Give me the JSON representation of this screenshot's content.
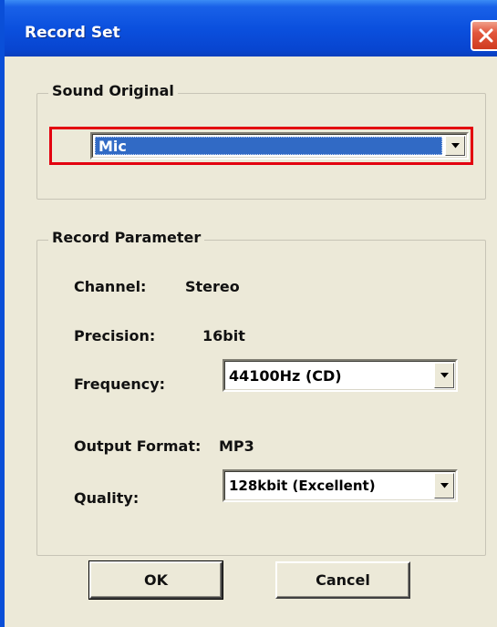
{
  "window": {
    "title": "Record Set"
  },
  "sound_original": {
    "legend": "Sound Original",
    "source_value": "Mic"
  },
  "record_parameter": {
    "legend": "Record Parameter",
    "channel_label": "Channel:",
    "channel_value": "Stereo",
    "precision_label": "Precision:",
    "precision_value": "16bit",
    "frequency_label": "Frequency:",
    "frequency_value": "44100Hz (CD)",
    "output_format_label": "Output Format:",
    "output_format_value": "MP3",
    "quality_label": "Quality:",
    "quality_value": "128kbit (Excellent)"
  },
  "buttons": {
    "ok": "OK",
    "cancel": "Cancel"
  },
  "colors": {
    "titlebar": "#0b50de",
    "dialog_bg": "#ece9d8",
    "selection": "#316ac5",
    "highlight_border": "#e3000f",
    "close_button": "#e2573c"
  },
  "icons": {
    "close": "close-x-icon",
    "dropdown": "chevron-down-icon"
  }
}
